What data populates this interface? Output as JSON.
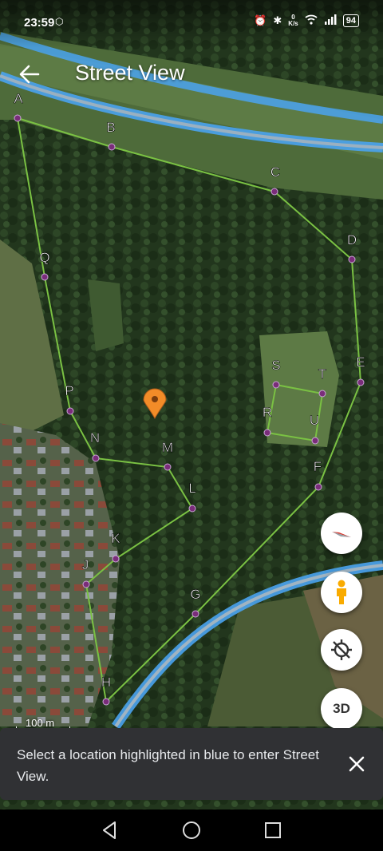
{
  "status": {
    "time": "23:59",
    "net_speed_value": "0",
    "net_speed_unit": "K/s",
    "battery": "94"
  },
  "header": {
    "title": "Street View"
  },
  "map": {
    "points": [
      {
        "label": "A"
      },
      {
        "label": "B"
      },
      {
        "label": "C"
      },
      {
        "label": "D"
      },
      {
        "label": "E"
      },
      {
        "label": "F"
      },
      {
        "label": "G"
      },
      {
        "label": "H"
      },
      {
        "label": "J"
      },
      {
        "label": "K"
      },
      {
        "label": "L"
      },
      {
        "label": "M"
      },
      {
        "label": "N"
      },
      {
        "label": "P"
      },
      {
        "label": "Q"
      },
      {
        "label": "S"
      },
      {
        "label": "T"
      },
      {
        "label": "U"
      },
      {
        "label": "R"
      }
    ],
    "scale_label": "100 m",
    "colors": {
      "boundary_line": "#7ac143",
      "street_view_road": "#4aa3f0",
      "marker": "#f28c28",
      "vertex": "#7a2d7a"
    }
  },
  "controls": {
    "compass_icon": "compass-icon",
    "pegman_icon": "pegman-icon",
    "location_icon": "location-off-icon",
    "view_3d_label": "3D"
  },
  "snackbar": {
    "message": "Select a location highlighted in blue to enter Street View."
  }
}
